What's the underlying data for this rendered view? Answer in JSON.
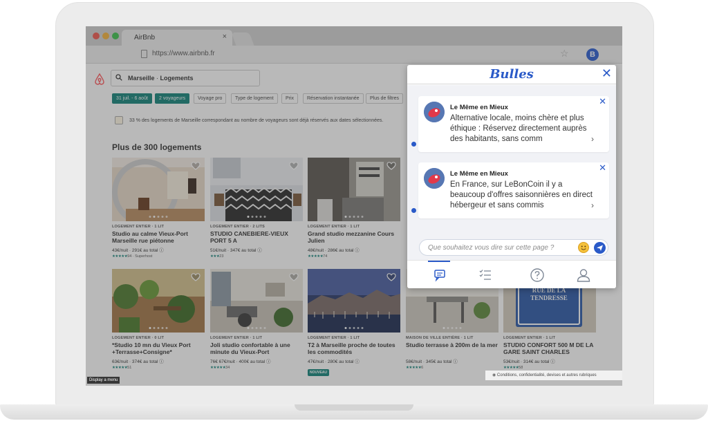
{
  "browser": {
    "tab_title": "AirBnb",
    "tab_close": "×",
    "url": "https://www.airbnb.fr",
    "star": "☆",
    "extension_letter": "B"
  },
  "airbnb": {
    "search_place": "Marseille",
    "search_sep": " · ",
    "search_type": "Logements",
    "filters": [
      "31 juil. - 6 août",
      "2 voyageurs",
      "Voyage pro",
      "Type de logement",
      "Prix",
      "Réservation instantanée",
      "Plus de filtres"
    ],
    "notice": "33 % des logements de Marseille correspondant au nombre de voyageurs sont déjà réservés aux dates sélectionnées.",
    "heading": "Plus de 300 logements",
    "listings": [
      {
        "type": "LOGEMENT ENTIER · 1 LIT",
        "title": "Studio au calme Vieux-Port Marseille rue piétonne",
        "price": "43€/nuit · 291€ au total ⓘ",
        "stars": "★★★★★",
        "reviews": "94 · Superhost",
        "badge": ""
      },
      {
        "type": "LOGEMENT ENTIER · 2 LITS",
        "title": "STUDIO CANEBIERE-VIEUX PORT 5 A",
        "price": "51€/nuit · 347€ au total ⓘ",
        "stars": "★★★",
        "reviews": "23",
        "badge": ""
      },
      {
        "type": "LOGEMENT ENTIER · 1 LIT",
        "title": "Grand studio mezzanine Cours Julien",
        "price": "48€/nuit · 286€ au total ⓘ",
        "stars": "★★★★★",
        "reviews": "74",
        "badge": ""
      },
      {
        "type": "LOGEMENT ENTIER · 0 LIT",
        "title": "*Studio 10 mn du Vieux Port +Terrasse+Consigne*",
        "price": "63€/nuit · 374€ au total ⓘ",
        "stars": "★★★★★",
        "reviews": "51",
        "badge": ""
      },
      {
        "type": "LOGEMENT ENTIER · 1 LIT",
        "title": "Joli studio confortable à une minute du Vieux-Port",
        "price": "76€ 67€/nuit · 400€ au total ⓘ",
        "stars": "★★★★★",
        "reviews": "34",
        "badge": ""
      },
      {
        "type": "LOGEMENT ENTIER · 1 LIT",
        "title": "T2 à Marseille proche de toutes les commodités",
        "price": "47€/nuit · 280€ au total ⓘ",
        "stars": "",
        "reviews": "",
        "badge": "NOUVEAU"
      },
      {
        "type": "MAISON DE VILLE ENTIÈRE · 1 LIT",
        "title": "Studio terrasse à 200m de la mer",
        "price": "58€/nuit · 345€ au total ⓘ",
        "stars": "★★★★★",
        "reviews": "6",
        "badge": ""
      },
      {
        "type": "LOGEMENT ENTIER · 1 LIT",
        "title": "STUDIO CONFORT 500 M DE LA GARE SAINT CHARLES",
        "price": "53€/nuit · 314€ au total ⓘ",
        "stars": "★★★★★",
        "reviews": "58",
        "badge": ""
      }
    ],
    "display_menu": "Display a menu",
    "footer": "Conditions, confidentialité, devises et autres rubriques",
    "sign_text": "RUE DE LA TENDRESSE"
  },
  "bulles": {
    "logo": "Bulles",
    "close": "✕",
    "messages": [
      {
        "sender": "Le Même en Mieux",
        "text": "Alternative locale, moins chère et plus éthique : Réservez directement auprès des habitants, sans comm",
        "close": "✕",
        "chevron": "›"
      },
      {
        "sender": "Le Même en Mieux",
        "text": "En France, sur LeBonCoin il y a beaucoup d'offres saisonnières en direct hébergeur et sans commis",
        "close": "✕",
        "chevron": "›"
      }
    ],
    "input_placeholder": "Que souhaitez vous dire sur cette page ?",
    "nav": [
      "chat-icon",
      "checklist-icon",
      "help-icon",
      "profile-icon"
    ]
  },
  "colors": {
    "accent": "#2a5ac8",
    "airbnb_teal": "#14847a",
    "airbnb_logo": "#ff5a5f"
  }
}
